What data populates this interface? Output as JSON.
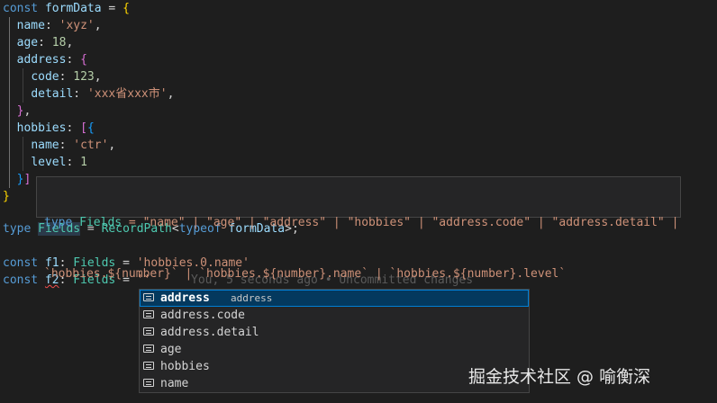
{
  "code": {
    "kw_const": "const",
    "kw_type": "type",
    "kw_typeof": "typeof",
    "var_formData": "formData",
    "key_name": "name",
    "key_age": "age",
    "key_address": "address",
    "key_code": "code",
    "key_detail": "detail",
    "key_hobbies": "hobbies",
    "key_level": "level",
    "str_xyz": "'xyz'",
    "num_18": "18",
    "num_123": "123",
    "str_detail": "'xxx省xxx市'",
    "str_ctr": "'ctr'",
    "num_1": "1",
    "type_Fields": "Fields",
    "type_RecordPath": "RecordPath",
    "var_f1": "f1",
    "var_f2": "f2",
    "str_hobbies0": "'hobbies.0.name'",
    "str_empty": "''",
    "blame": "You, 5 seconds ago • Uncommitted changes"
  },
  "hover": {
    "line1_prefix": "type",
    "line1_name": "Fields",
    "line1_rest": " = \"name\" | \"age\" | \"address\" | \"hobbies\" | \"address.code\" | \"address.detail\" |",
    "line2": "`hobbies.${number}` | `hobbies.${number}.name` | `hobbies.${number}.level`"
  },
  "suggestions": {
    "items": [
      {
        "label": "address",
        "detail": "address",
        "selected": true
      },
      {
        "label": "address.code",
        "detail": ""
      },
      {
        "label": "address.detail",
        "detail": ""
      },
      {
        "label": "age",
        "detail": ""
      },
      {
        "label": "hobbies",
        "detail": ""
      },
      {
        "label": "name",
        "detail": ""
      }
    ],
    "icon": "field-icon"
  },
  "watermark": "掘金技术社区 @ 喻衡深",
  "colors": {
    "background": "#1e1e1e",
    "keyword": "#569cd6",
    "variable": "#9cdcfe",
    "type": "#4ec9b0",
    "string": "#ce9178",
    "number": "#b5cea8",
    "selection": "#04395e"
  }
}
